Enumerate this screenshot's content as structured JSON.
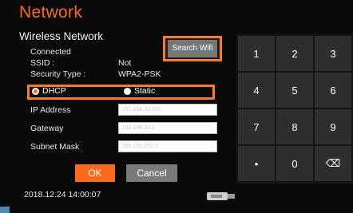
{
  "header": {
    "title": "Network",
    "subtitle": "Wireless Network"
  },
  "status": {
    "connected_label": "Connected",
    "ssid_label": "SSID :",
    "ssid_value": "Not",
    "security_label": "Security Type :",
    "security_value": "WPA2-PSK"
  },
  "search_wifi": {
    "label": "Search Wifi"
  },
  "mode": {
    "dhcp_label": "DHCP",
    "static_label": "Static",
    "selected": "DHCP"
  },
  "fields": {
    "ip_label": "IP Address",
    "ip_placeholder": "192.168.33.101",
    "gateway_label": "Gateway",
    "gateway_placeholder": "192.168.33.1",
    "subnet_label": "Subnet Mask",
    "subnet_placeholder": "255.255.255.0"
  },
  "actions": {
    "ok_label": "OK",
    "cancel_label": "Cancel"
  },
  "footer": {
    "datetime": "2018.12.24  14:00:07",
    "usb_icon": "usb-drive-icon"
  },
  "keypad": {
    "keys": [
      "1",
      "2",
      "3",
      "4",
      "5",
      "6",
      "7",
      "8",
      "9",
      "•",
      "0",
      "⌫"
    ]
  },
  "colors": {
    "accent": "#ff6a1a",
    "keypad_key": "#2e2e2e",
    "background": "#0a0a0a"
  }
}
